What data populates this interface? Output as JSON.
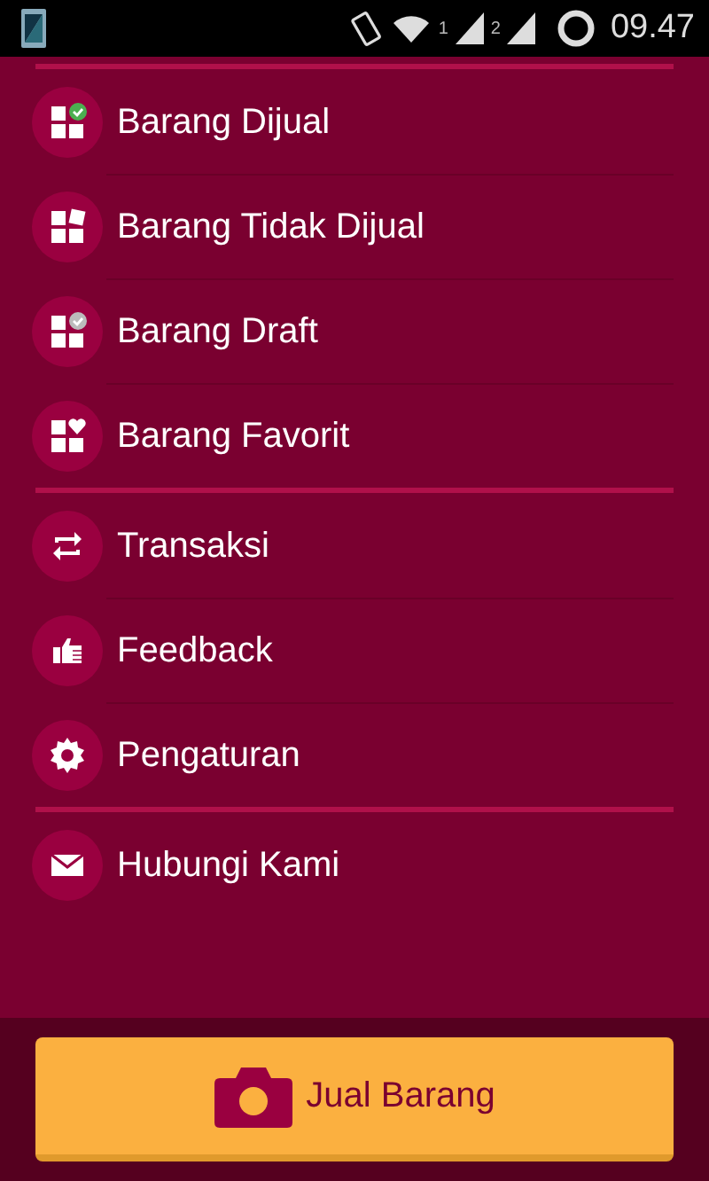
{
  "status_bar": {
    "sim_1": "1",
    "sim_2": "2",
    "time": "09.47"
  },
  "sections": [
    {
      "items": [
        {
          "kind": "sold",
          "label": "Barang Dijual"
        },
        {
          "kind": "unsold",
          "label": "Barang Tidak Dijual"
        },
        {
          "kind": "draft",
          "label": "Barang Draft"
        },
        {
          "kind": "favorite",
          "label": "Barang Favorit"
        }
      ]
    },
    {
      "items": [
        {
          "kind": "transaction",
          "label": "Transaksi"
        },
        {
          "kind": "feedback",
          "label": "Feedback"
        },
        {
          "kind": "settings",
          "label": "Pengaturan"
        }
      ]
    },
    {
      "items": [
        {
          "kind": "contact",
          "label": "Hubungi Kami"
        }
      ]
    }
  ],
  "sell_button": {
    "label": "Jual Barang"
  }
}
